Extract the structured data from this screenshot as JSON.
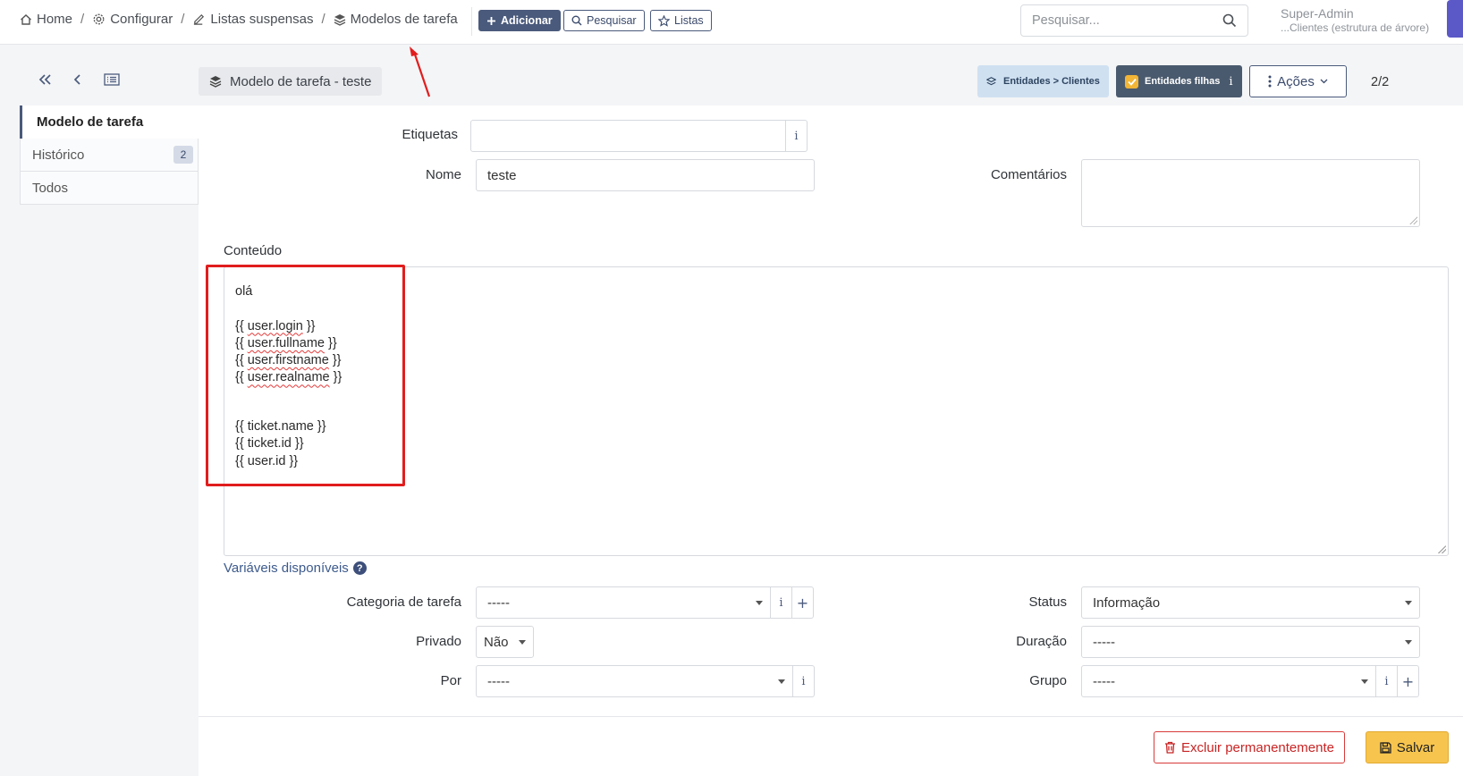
{
  "breadcrumb": {
    "home": "Home",
    "configurar": "Configurar",
    "listas": "Listas suspensas",
    "modelos": "Modelos de tarefa"
  },
  "toolbar": {
    "add_label": "Adicionar",
    "search_label": "Pesquisar",
    "lists_label": "Listas"
  },
  "top_search": {
    "placeholder": "Pesquisar..."
  },
  "user": {
    "name": "Super-Admin",
    "entity": "...Clientes (estrutura de árvore)"
  },
  "header": {
    "title": "Modelo de tarefa - teste",
    "entity_badge": "Entidades > Clientes",
    "child_entities": "Entidades filhas",
    "actions_label": "Ações",
    "pager": "2/2"
  },
  "leftnav": {
    "items": [
      {
        "label": "Modelo de tarefa"
      },
      {
        "label": "Histórico",
        "count": "2"
      },
      {
        "label": "Todos"
      }
    ]
  },
  "form": {
    "etiquetas_label": "Etiquetas",
    "etiquetas_value": "",
    "nome_label": "Nome",
    "nome_value": "teste",
    "comentarios_label": "Comentários",
    "conteudo_label": "Conteúdo",
    "content_lines": [
      {
        "before": "olá",
        "ref": "",
        "after": ""
      },
      {
        "before": "",
        "ref": "",
        "after": ""
      },
      {
        "before": "{{ ",
        "ref": "user.login",
        "after": " }}"
      },
      {
        "before": "{{ ",
        "ref": "user.fullname",
        "after": " }}"
      },
      {
        "before": "{{ ",
        "ref": "user.firstname",
        "after": " }}"
      },
      {
        "before": "{{ ",
        "ref": "user.realname",
        "after": " }}"
      },
      {
        "before": "",
        "ref": "",
        "after": ""
      },
      {
        "before": "",
        "ref": "",
        "after": ""
      },
      {
        "before": "{{ ticket.name }}",
        "ref": "",
        "after": ""
      },
      {
        "before": "{{ ticket.id }}",
        "ref": "",
        "after": ""
      },
      {
        "before": "{{ user.id }}",
        "ref": "",
        "after": ""
      }
    ],
    "vars_link": "Variáveis disponíveis",
    "categoria_label": "Categoria de tarefa",
    "categoria_value": "-----",
    "status_label": "Status",
    "status_value": "Informação",
    "privado_label": "Privado",
    "privado_value": "Não",
    "duracao_label": "Duração",
    "duracao_value": "-----",
    "por_label": "Por",
    "por_value": "-----",
    "grupo_label": "Grupo",
    "grupo_value": "-----"
  },
  "footer": {
    "delete_label": "Excluir permanentemente",
    "save_label": "Salvar"
  },
  "colors": {
    "accent": "#4a5a7c",
    "annotation_red": "#e11d1d",
    "save_yellow": "#f7c54e",
    "danger": "#c82424"
  }
}
